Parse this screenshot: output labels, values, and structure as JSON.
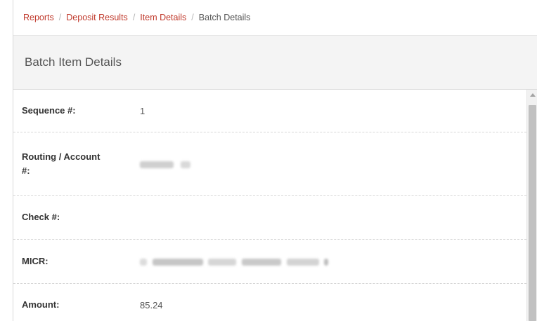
{
  "breadcrumb": {
    "items": [
      "Reports",
      "Deposit Results",
      "Item Details"
    ],
    "current": "Batch Details",
    "separator": "/"
  },
  "panel": {
    "title": "Batch Item Details"
  },
  "fields": {
    "sequence": {
      "label": "Sequence #:",
      "value": "1"
    },
    "routing_account": {
      "label_line1": "Routing / Account",
      "label_line2": "#:",
      "value": "",
      "value_redacted": true
    },
    "check": {
      "label": "Check #:",
      "value": ""
    },
    "micr": {
      "label": "MICR:",
      "value": "",
      "value_redacted": true
    },
    "amount": {
      "label": "Amount:",
      "value": "85.24"
    }
  },
  "colors": {
    "link": "#c0392b",
    "header_bg": "#f4f4f4",
    "label": "#333333",
    "value": "#555555"
  },
  "icons": {
    "scroll_up": "scroll-up-arrow-icon"
  }
}
